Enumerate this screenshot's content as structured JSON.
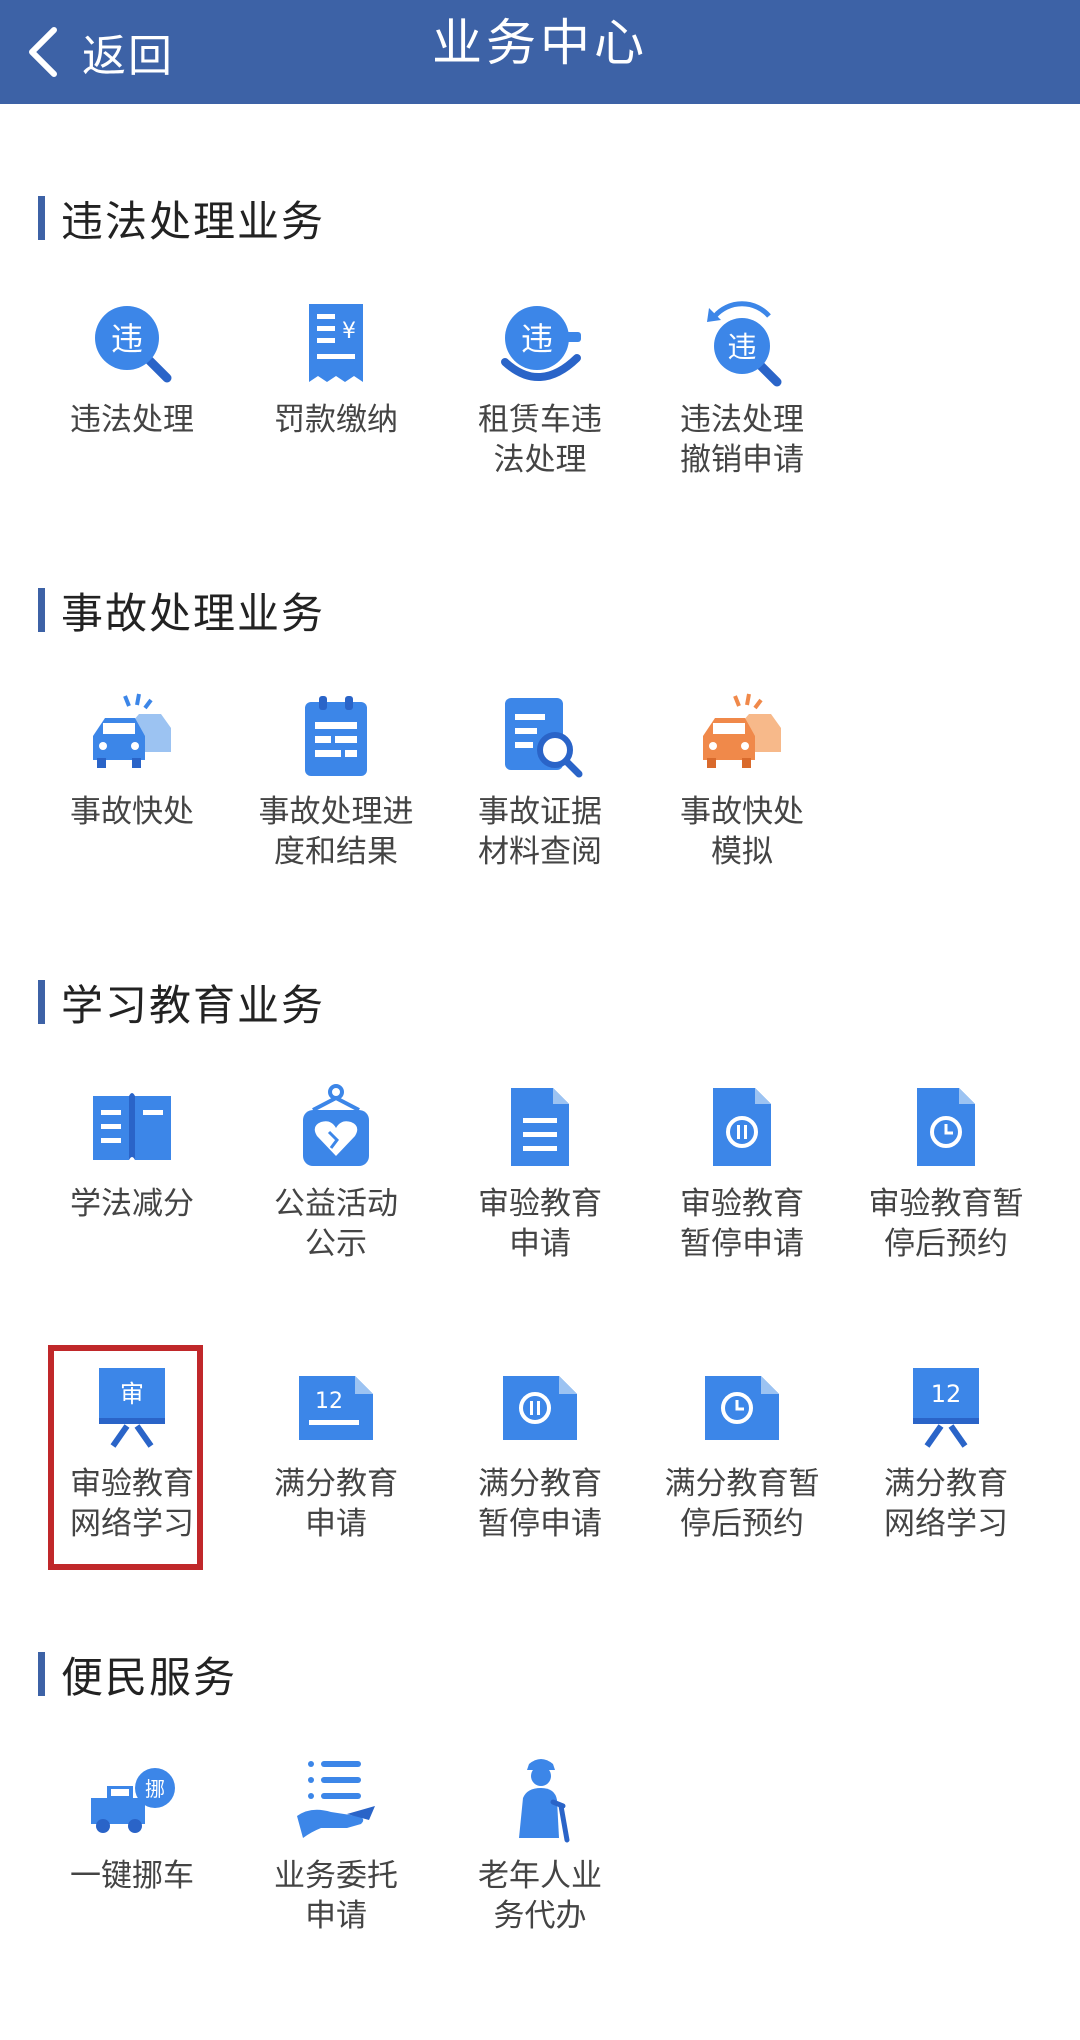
{
  "header": {
    "back_label": "返回",
    "title": "业务中心",
    "background": "#3d62a6"
  },
  "sections": [
    {
      "title": "违法处理业务",
      "items": [
        {
          "label": "违法处理",
          "icon": "violation-search-icon"
        },
        {
          "label": "罚款缴纳",
          "icon": "fine-receipt-icon"
        },
        {
          "label": "租赁车违\n法处理",
          "icon": "rental-violation-icon"
        },
        {
          "label": "违法处理\n撤销申请",
          "icon": "violation-revoke-icon"
        }
      ]
    },
    {
      "title": "事故处理业务",
      "items": [
        {
          "label": "事故快处",
          "icon": "car-crash-icon"
        },
        {
          "label": "事故处理进\n度和结果",
          "icon": "progress-clipboard-icon"
        },
        {
          "label": "事故证据\n材料查阅",
          "icon": "evidence-search-icon"
        },
        {
          "label": "事故快处\n模拟",
          "icon": "crash-simulation-icon"
        }
      ]
    },
    {
      "title": "学习教育业务",
      "items": [
        {
          "label": "学法减分",
          "icon": "open-book-icon"
        },
        {
          "label": "公益活动\n公示",
          "icon": "charity-heart-icon"
        },
        {
          "label": "审验教育\n申请",
          "icon": "document-icon"
        },
        {
          "label": "审验教育\n暂停申请",
          "icon": "document-pause-icon"
        },
        {
          "label": "审验教育暂\n停后预约",
          "icon": "document-clock-icon"
        },
        {
          "label": "审验教育\n网络学习",
          "icon": "online-review-board-icon",
          "board_text": "审"
        },
        {
          "label": "满分教育\n申请",
          "icon": "score-document-icon",
          "board_text": "12"
        },
        {
          "label": "满分教育\n暂停申请",
          "icon": "score-pause-icon"
        },
        {
          "label": "满分教育暂\n停后预约",
          "icon": "score-clock-icon"
        },
        {
          "label": "满分教育\n网络学习",
          "icon": "online-score-board-icon",
          "board_text": "12"
        }
      ]
    },
    {
      "title": "便民服务",
      "items": [
        {
          "label": "一键挪车",
          "icon": "move-truck-icon",
          "badge_text": "挪"
        },
        {
          "label": "业务委托\n申请",
          "icon": "delegate-hand-icon"
        },
        {
          "label": "老年人业\n务代办",
          "icon": "elderly-person-icon"
        }
      ]
    }
  ],
  "colors": {
    "icon_blue": "#3c86e8",
    "icon_blue_dark": "#2a64c8",
    "icon_orange": "#f0894a",
    "highlight": "#c0282a"
  }
}
